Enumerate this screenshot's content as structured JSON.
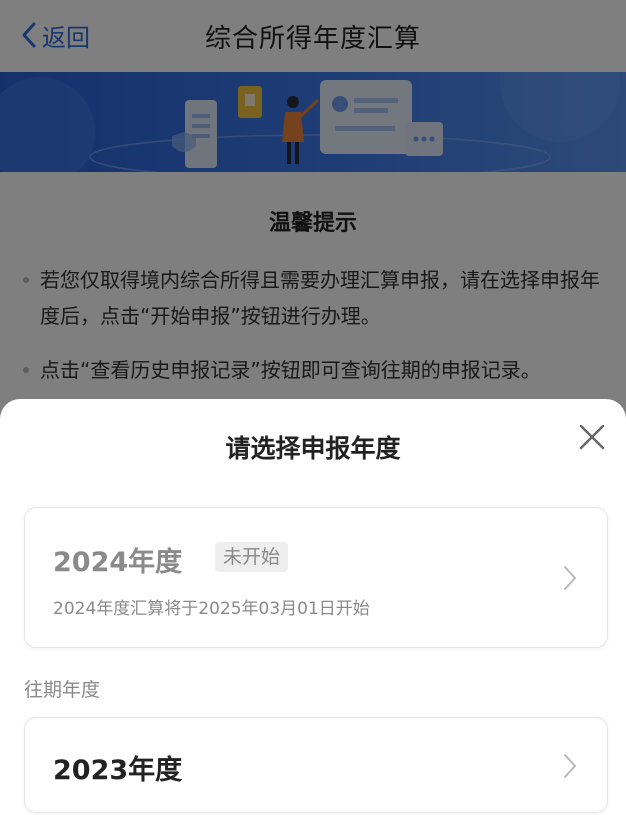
{
  "nav": {
    "back_label": "返回",
    "title": "综合所得年度汇算"
  },
  "tips": {
    "title": "温馨提示",
    "items": [
      "若您仅取得境内综合所得且需要办理汇算申报，请在选择申报年度后，点击“开始申报”按钮进行办理。",
      "点击“查看历史申报记录”按钮即可查询往期的申报记录。"
    ]
  },
  "sheet": {
    "title": "请选择申报年度",
    "current_year": {
      "label": "2024年度",
      "status_badge": "未开始",
      "description": "2024年度汇算将于2025年03月01日开始"
    },
    "past_section_label": "往期年度",
    "past_years": [
      {
        "label": "2023年度"
      }
    ]
  },
  "colors": {
    "accent": "#2f6fe0",
    "banner_blue": "#2a63d8",
    "overlay": "rgba(0,0,0,0.5)"
  }
}
